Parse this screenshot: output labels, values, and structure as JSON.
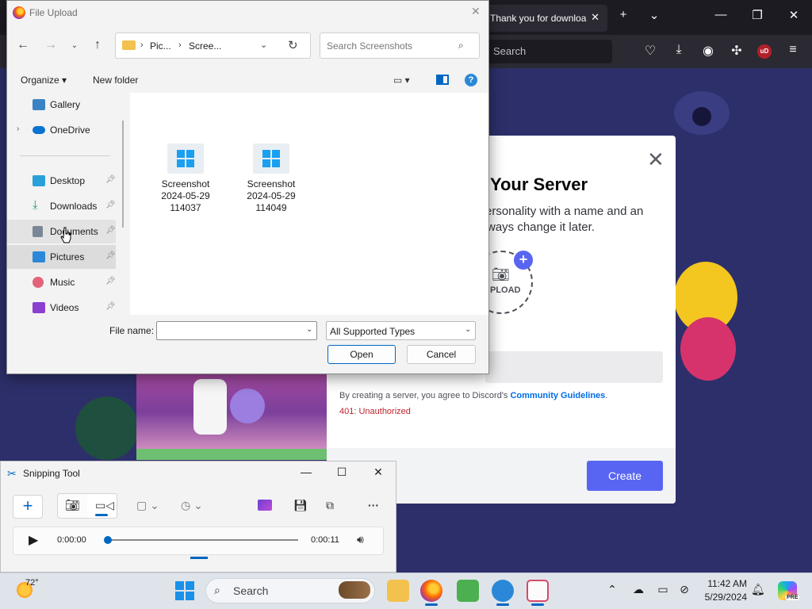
{
  "firefox": {
    "tab_title": "Thank you for downloa",
    "tab_close": "✕",
    "new_tab": "+",
    "tab_list": "⌄",
    "minimize": "—",
    "restore": "❐",
    "close": "✕",
    "search_placeholder": "Search",
    "toolbar_icons": [
      "pocket-icon",
      "download-icon",
      "account-icon",
      "extensions-icon",
      "ublock-icon",
      "menu-icon"
    ],
    "ublock_label": "uD"
  },
  "discord": {
    "close": "✕",
    "title": "e Your Server",
    "subtitle_line1": "ersonality with a name and an",
    "subtitle_line2": "ways change it later.",
    "upload_label": "PLOAD",
    "upload_plus": "+",
    "agreement_prefix": "By creating a server, you agree to Discord's ",
    "agreement_link": "Community Guidelines",
    "agreement_suffix": ".",
    "error": "401: Unauthorized",
    "create_button": "Create",
    "colors": {
      "blurple": "#5865f2",
      "error": "#c0232a",
      "link": "#006ce7"
    }
  },
  "file_dialog": {
    "title": "File Upload",
    "close": "✕",
    "breadcrumb": [
      "Pic...",
      "Scree..."
    ],
    "search_placeholder": "Search Screenshots",
    "organize": "Organize ▾",
    "new_folder": "New folder",
    "help": "?",
    "nav_items": [
      {
        "label": "Gallery",
        "icon": "gallery-icon",
        "color": "#3b82c4",
        "pinned": false
      },
      {
        "label": "OneDrive",
        "icon": "onedrive-icon",
        "color": "#0a72d1",
        "pinned": false
      },
      {
        "label": "Desktop",
        "icon": "desktop-icon",
        "color": "#2aa0d8",
        "pinned": true
      },
      {
        "label": "Downloads",
        "icon": "downloads-icon",
        "color": "#1e9e6a",
        "pinned": true
      },
      {
        "label": "Documents",
        "icon": "documents-icon",
        "color": "#7a8797",
        "pinned": true
      },
      {
        "label": "Pictures",
        "icon": "pictures-icon",
        "color": "#2b88d8",
        "pinned": true
      },
      {
        "label": "Music",
        "icon": "music-icon",
        "color": "#e2637a",
        "pinned": true
      },
      {
        "label": "Videos",
        "icon": "videos-icon",
        "color": "#8a3fd1",
        "pinned": true
      }
    ],
    "files": [
      {
        "line1": "Screenshot",
        "line2": "2024-05-29",
        "line3": "114037"
      },
      {
        "line1": "Screenshot",
        "line2": "2024-05-29",
        "line3": "114049"
      }
    ],
    "file_name_label": "File name:",
    "file_name_value": "",
    "file_type": "All Supported Types",
    "open_button": "Open",
    "cancel_button": "Cancel"
  },
  "snipping_tool": {
    "title": "Snipping Tool",
    "minimize": "—",
    "maximize": "☐",
    "close": "✕",
    "new": "+",
    "more": "···",
    "time_current": "0:00:00",
    "time_total": "0:00:11",
    "playback_progress": 0
  },
  "taskbar": {
    "temperature": "72°",
    "search": "Search",
    "time": "11:42 AM",
    "date": "5/29/2024",
    "copilot_badge": "PRE",
    "apps": [
      {
        "name": "file-explorer-icon",
        "color": "#f2c14e",
        "running": false
      },
      {
        "name": "firefox-icon",
        "color": "#ff6a00",
        "running": true
      },
      {
        "name": "notepad-app-icon",
        "color": "#4caf50",
        "running": false
      },
      {
        "name": "maps-app-icon",
        "color": "#2b88d8",
        "running": true
      },
      {
        "name": "snipping-tool-icon",
        "color": "#d64a6a",
        "running": true
      }
    ]
  }
}
